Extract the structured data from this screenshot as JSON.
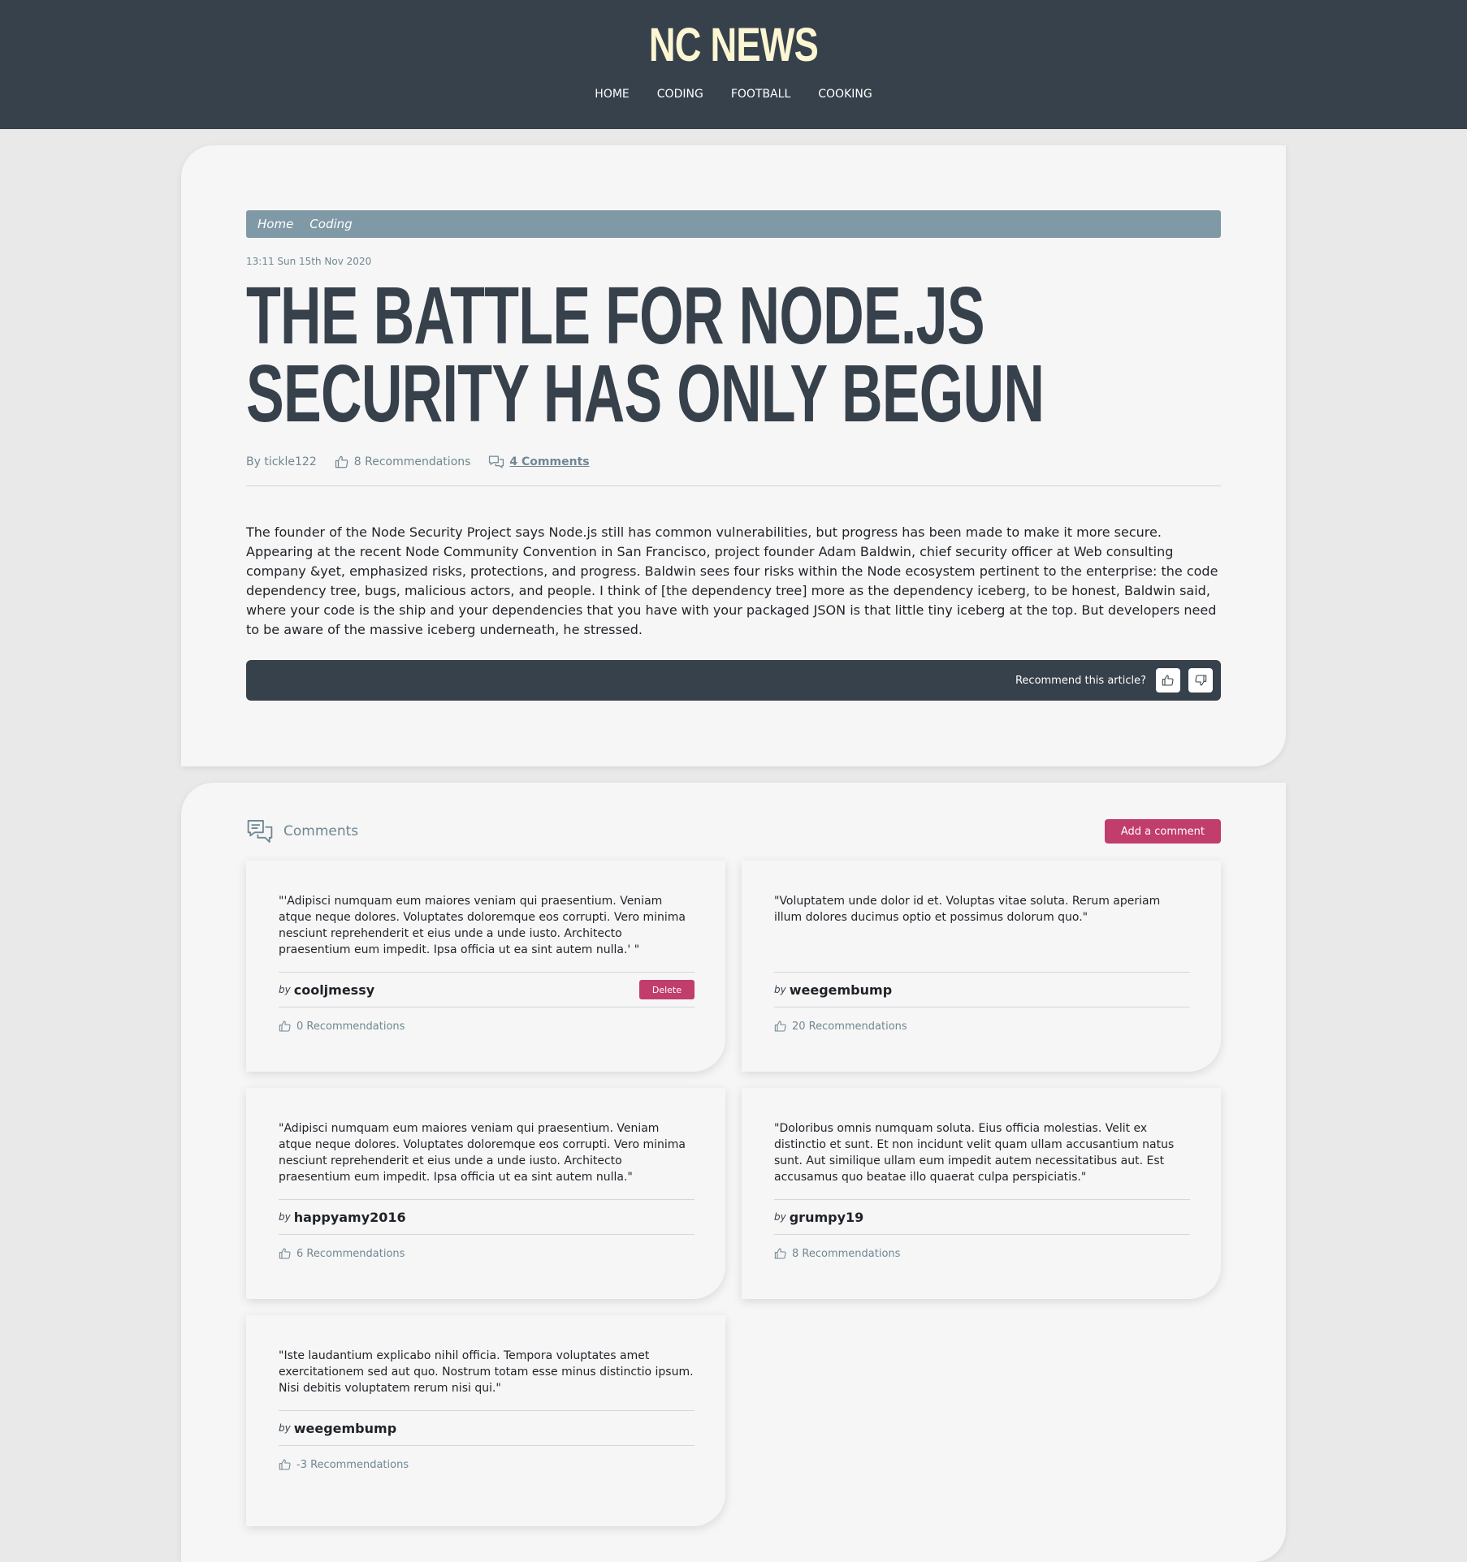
{
  "header": {
    "logo": "NC NEWS",
    "nav": [
      "HOME",
      "CODING",
      "FOOTBALL",
      "COOKING"
    ]
  },
  "article": {
    "breadcrumb": [
      "Home",
      "Coding"
    ],
    "date": "13:11 Sun 15th Nov 2020",
    "title": "THE BATTLE FOR NODE.JS SECURITY HAS ONLY BEGUN",
    "author": "By tickle122",
    "recommendations": "8 Recommendations",
    "comments_link": "4 Comments",
    "body": "The founder of the Node Security Project says Node.js still has common vulnerabilities, but progress has been made to make it more secure. Appearing at the recent Node Community Convention in San Francisco, project founder Adam Baldwin, chief security officer at Web consulting company &yet, emphasized risks, protections, and progress. Baldwin sees four risks within the Node ecosystem pertinent to the enterprise: the code dependency tree, bugs, malicious actors, and people. I think of [the dependency tree] more as the dependency iceberg, to be honest, Baldwin said, where your code is the ship and your dependencies that you have with your packaged JSON is that little tiny iceberg at the top. But developers need to be aware of the massive iceberg underneath, he stressed.",
    "recommend_prompt": "Recommend this article?"
  },
  "comments_section": {
    "title": "Comments",
    "add_label": "Add a comment",
    "by_label": "by",
    "delete_label": "Delete",
    "items": [
      {
        "text": "\"'Adipisci numquam eum maiores veniam qui praesentium. Veniam atque neque dolores. Voluptates doloremque eos corrupti. Vero minima nesciunt reprehenderit et eius unde a unde iusto. Architecto praesentium eum impedit. Ipsa officia ut ea sint autem nulla.' \"",
        "user": "cooljmessy",
        "recommendations": "0 Recommendations",
        "deletable": true
      },
      {
        "text": "\"Voluptatem unde dolor id et. Voluptas vitae soluta. Rerum aperiam illum dolores ducimus optio et possimus dolorum quo.\"",
        "user": "weegembump",
        "recommendations": "20 Recommendations",
        "deletable": false
      },
      {
        "text": "\"Adipisci numquam eum maiores veniam qui praesentium. Veniam atque neque dolores. Voluptates doloremque eos corrupti. Vero minima nesciunt reprehenderit et eius unde a unde iusto. Architecto praesentium eum impedit. Ipsa officia ut ea sint autem nulla.\"",
        "user": "happyamy2016",
        "recommendations": "6 Recommendations",
        "deletable": false
      },
      {
        "text": "\"Doloribus omnis numquam soluta. Eius officia molestias. Velit ex distinctio et sunt. Et non incidunt velit quam ullam accusantium natus sunt. Aut similique ullam eum impedit autem necessitatibus aut. Est accusamus quo beatae illo quaerat culpa perspiciatis.\"",
        "user": "grumpy19",
        "recommendations": "8 Recommendations",
        "deletable": false
      },
      {
        "text": "\"Iste laudantium explicabo nihil officia. Tempora voluptates amet exercitationem sed aut quo. Nostrum totam esse minus distinctio ipsum. Nisi debitis voluptatem rerum nisi qui.\"",
        "user": "weegembump",
        "recommendations": "-3 Recommendations",
        "deletable": false
      }
    ]
  },
  "colors": {
    "header_bg": "#37414b",
    "logo": "#fdf6d3",
    "accent": "#c13d6b",
    "breadcrumb_bg": "#7f9aa6",
    "muted_text": "#6f8793"
  },
  "icons": {
    "recommend": "thumbs-up-icon",
    "comments": "speech-bubbles-icon",
    "upvote": "thumbs-up-icon",
    "downvote": "thumbs-down-icon"
  }
}
